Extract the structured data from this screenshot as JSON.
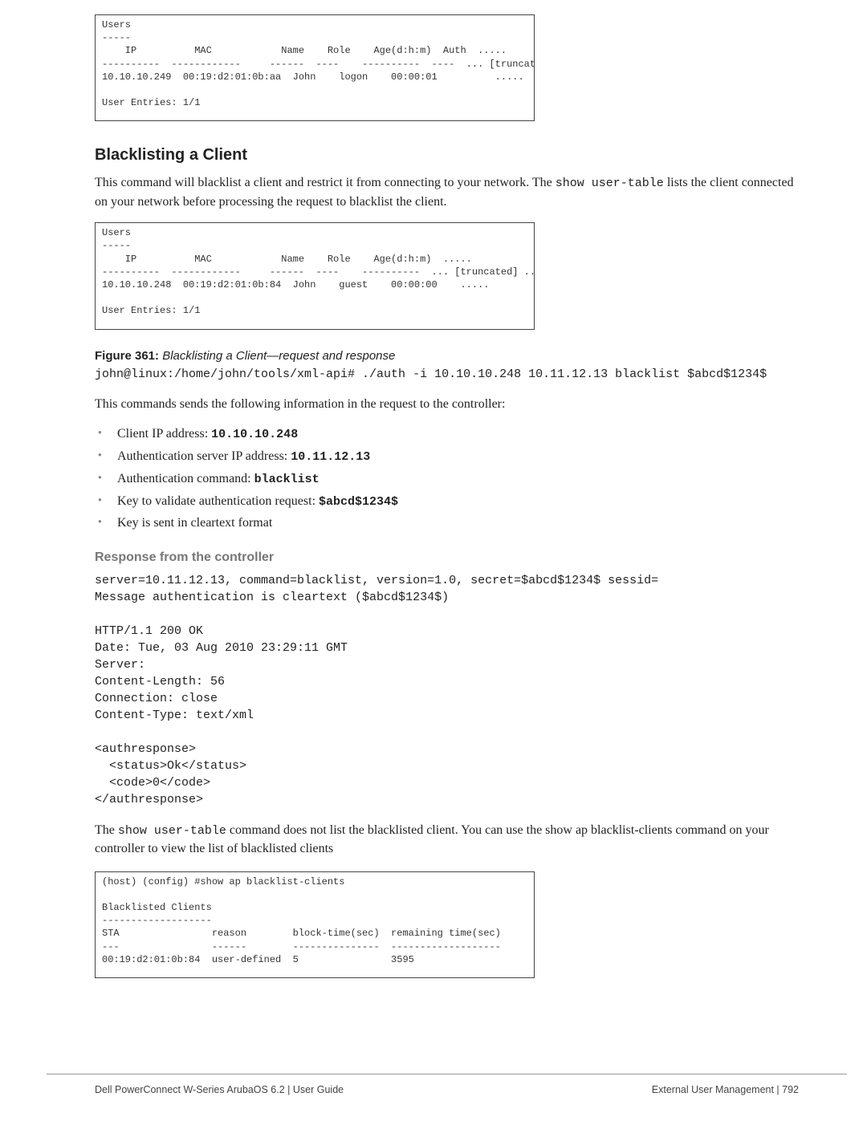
{
  "term_boxes": {
    "box1": "Users\n-----\n    IP          MAC            Name    Role    Age(d:h:m)  Auth  .....\n----------  ------------     ------  ----    ----------  ----  ... [truncated]\n10.10.10.249  00:19:d2:01:0b:aa  John    logon    00:00:01          .....\n\nUser Entries: 1/1",
    "box2": "Users\n-----\n    IP          MAC            Name    Role    Age(d:h:m)  .....\n----------  ------------     ------  ----    ----------  ... [truncated] ...\n10.10.10.248  00:19:d2:01:0b:84  John    guest    00:00:00    .....\n\nUser Entries: 1/1",
    "box3": "(host) (config) #show ap blacklist-clients\n\nBlacklisted Clients\n-------------------\nSTA                reason        block-time(sec)  remaining time(sec)\n---                ------        ---------------  -------------------\n00:19:d2:01:0b:84  user-defined  5                3595"
  },
  "section_heading": "Blacklisting a Client",
  "intro_para_parts": {
    "p1a": "This command will blacklist a client and restrict it from connecting to your network. The ",
    "code1": "show user-table",
    "p1b": " lists the client connected on your network before processing the request to blacklist the client."
  },
  "figure": {
    "label": "Figure 361:",
    "title": "Blacklisting a Client—request and response"
  },
  "command_line": "john@linux:/home/john/tools/xml-api# ./auth -i 10.10.10.248 10.11.12.13 blacklist $abcd$1234$",
  "sends_para": "This commands sends the following information in the request to the controller:",
  "bullets": [
    {
      "text": "Client IP address: ",
      "code": "10.10.10.248"
    },
    {
      "text": "Authentication server IP address: ",
      "code": "10.11.12.13"
    },
    {
      "text": "Authentication command: ",
      "code": "blacklist"
    },
    {
      "text": "Key to validate authentication request: ",
      "code": "$abcd$1234$"
    },
    {
      "text": "Key is sent in cleartext format",
      "code": ""
    }
  ],
  "response_heading": "Response from the controller",
  "response_block": "server=10.11.12.13, command=blacklist, version=1.0, secret=$abcd$1234$ sessid=\nMessage authentication is cleartext ($abcd$1234$)\n\nHTTP/1.1 200 OK\nDate: Tue, 03 Aug 2010 23:29:11 GMT\nServer:\nContent-Length: 56\nConnection: close\nContent-Type: text/xml\n\n<authresponse>\n  <status>Ok</status>\n  <code>0</code>\n</authresponse>",
  "after_response_parts": {
    "a": "The ",
    "code": "show user-table",
    "b": " command does not list the blacklisted client. You can use the show ap blacklist-clients command on your controller to view the list of blacklisted clients"
  },
  "footer": {
    "left": "Dell PowerConnect W-Series ArubaOS 6.2  |  User Guide",
    "right": "External User Management  |  792"
  }
}
